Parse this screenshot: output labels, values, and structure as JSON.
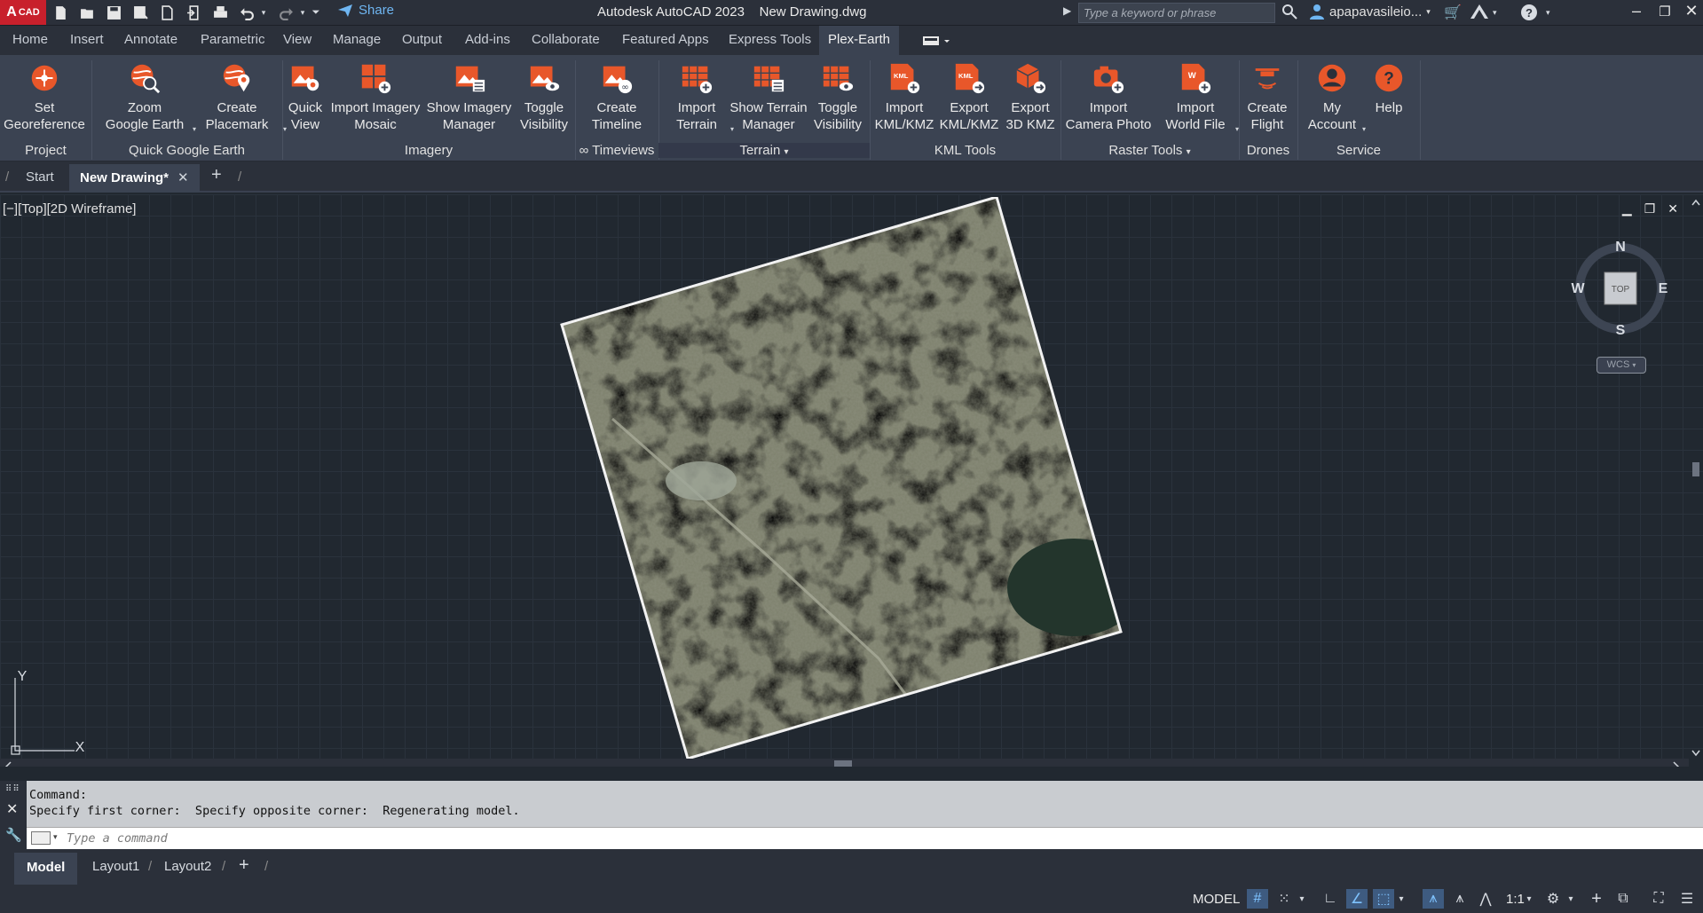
{
  "app": {
    "badge": "CAD",
    "title": "Autodesk AutoCAD 2023",
    "document": "New Drawing.dwg",
    "share_label": "Share",
    "search_placeholder": "Type a keyword or phrase",
    "user": "apapavasileio..."
  },
  "ribbon_tabs": [
    "Home",
    "Insert",
    "Annotate",
    "Parametric",
    "View",
    "Manage",
    "Output",
    "Add-ins",
    "Collaborate",
    "Featured Apps",
    "Express Tools",
    "Plex-Earth"
  ],
  "active_tab": "Plex-Earth",
  "ribbon": {
    "buttons": [
      {
        "line1": "Set",
        "line2": "Georeference",
        "icon": "georeference-icon"
      },
      {
        "line1": "Zoom",
        "line2": "Google Earth",
        "icon": "zoom-google-earth-icon"
      },
      {
        "line1": "Create",
        "line2": "Placemark",
        "icon": "placemark-icon"
      },
      {
        "line1": "Quick",
        "line2": "View",
        "icon": "quick-view-icon"
      },
      {
        "line1": "Import Imagery",
        "line2": "Mosaic",
        "icon": "imagery-mosaic-icon"
      },
      {
        "line1": "Show Imagery",
        "line2": "Manager",
        "icon": "imagery-manager-icon"
      },
      {
        "line1": "Toggle",
        "line2": "Visibility",
        "icon": "imagery-visibility-icon"
      },
      {
        "line1": "Create",
        "line2": "Timeline",
        "icon": "timeline-icon"
      },
      {
        "line1": "Import",
        "line2": "Terrain",
        "icon": "import-terrain-icon"
      },
      {
        "line1": "Show Terrain",
        "line2": "Manager",
        "icon": "terrain-manager-icon"
      },
      {
        "line1": "Toggle",
        "line2": "Visibility",
        "icon": "terrain-visibility-icon"
      },
      {
        "line1": "Import",
        "line2": "KML/KMZ",
        "icon": "import-kml-icon"
      },
      {
        "line1": "Export",
        "line2": "KML/KMZ",
        "icon": "export-kml-icon"
      },
      {
        "line1": "Export",
        "line2": "3D KMZ",
        "icon": "export-3d-kmz-icon"
      },
      {
        "line1": "Import",
        "line2": "Camera Photo",
        "icon": "camera-photo-icon"
      },
      {
        "line1": "Import",
        "line2": "World File",
        "icon": "world-file-icon"
      },
      {
        "line1": "Create",
        "line2": "Flight",
        "icon": "drone-icon"
      },
      {
        "line1": "My",
        "line2": "Account",
        "icon": "account-icon"
      },
      {
        "line1": "Help",
        "line2": "",
        "icon": "help-icon"
      }
    ],
    "panels": [
      "Project",
      "Quick Google Earth",
      "Imagery",
      "∞ Timeviews",
      "Terrain",
      "KML Tools",
      "Raster Tools",
      "Drones",
      "Service"
    ]
  },
  "file_tabs": {
    "start": "Start",
    "active": "New Drawing*"
  },
  "viewport": {
    "label": "[−][Top][2D Wireframe]",
    "compass": {
      "n": "N",
      "s": "S",
      "e": "E",
      "w": "W",
      "center": "TOP"
    },
    "wcs": "WCS",
    "ucs_x": "X",
    "ucs_y": "Y"
  },
  "command": {
    "line1": "Command:",
    "line2": "Specify first corner:  Specify opposite corner:  Regenerating model.",
    "placeholder": "Type a command"
  },
  "layout_tabs": [
    "Model",
    "Layout1",
    "Layout2"
  ],
  "status": {
    "model": "MODEL",
    "scale": "1:1"
  },
  "colors": {
    "accent_orange": "#e8572a",
    "panel_bg": "#3b4352",
    "titlebar_bg": "#2b303a",
    "viewport_bg": "#212830"
  }
}
